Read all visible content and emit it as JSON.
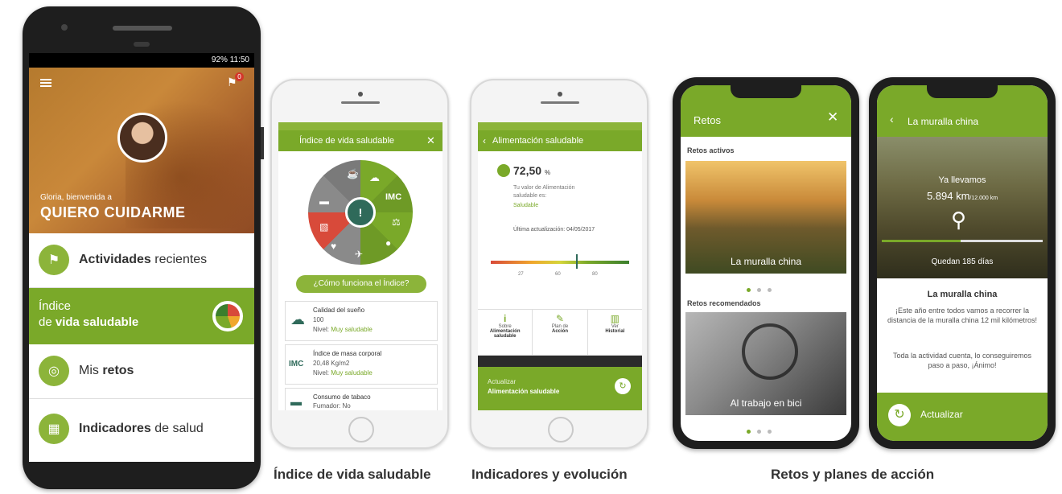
{
  "phone1": {
    "status": "92% 11:50",
    "notif_count": "0",
    "greeting": "Gloria, bienvenida a",
    "brand": "QUIERO CUIDARME",
    "menu": [
      {
        "bold": "Actividades",
        "rest": " recientes"
      },
      {
        "line1": "Índice",
        "line2_pre": "de ",
        "line2_bold": "vida saludable"
      },
      {
        "pre": "Mis ",
        "bold": "retos"
      },
      {
        "bold": "Indicadores",
        "rest": " de salud"
      }
    ]
  },
  "phone2": {
    "title": "Índice de vida saludable",
    "center": "!",
    "imc": "IMC",
    "how_button": "¿Cómo funciona el Índice?",
    "rows": [
      {
        "title": "Calidad del sueño",
        "value": "100",
        "level_label": "Nivel:",
        "level": "Muy saludable"
      },
      {
        "title": "Índice de masa corporal",
        "value": "20,48 Kg/m2",
        "level_label": "Nivel:",
        "level": "Muy saludable",
        "icon": "IMC"
      },
      {
        "title": "Consumo de tabaco",
        "value": "Fumador: No"
      }
    ]
  },
  "phone3": {
    "title": "Alimentación saludable",
    "score": "72,50",
    "score_unit": "%",
    "text1": "Tu valor de Alimentación",
    "text2": "saludable es:",
    "status": "Saludable",
    "updated": "Última actualización: 04/05/2017",
    "scale": [
      "27",
      "60",
      "80"
    ],
    "actions": [
      {
        "icon": "i",
        "l1": "Sobre",
        "l2": "Alimentación",
        "l3": "saludable"
      },
      {
        "icon": "✎",
        "l1": "Plan de",
        "l2": "Acción",
        "l3": ""
      },
      {
        "icon": "▥",
        "l1": "Ver",
        "l2": "Historial",
        "l3": ""
      }
    ],
    "update_label": "Actualizar",
    "update_target": "Alimentación saludable"
  },
  "phone4": {
    "title": "Retos",
    "active_label": "Retos activos",
    "active_card": "La muralla china",
    "recommended_label": "Retos recomendados",
    "recommended_card": "Al trabajo en bici"
  },
  "phone5": {
    "title": "La muralla china",
    "already": "Ya llevamos",
    "km": "5.894 km",
    "km_total": "/12.000 km",
    "remaining": "Quedan 185 días",
    "heading": "La muralla china",
    "body1": "¡Este año entre todos vamos a recorrer la distancia de la muralla china 12 mil kilómetros!",
    "body2": "Toda la actividad cuenta, lo conseguiremos paso a paso, ¡Ánimo!",
    "button": "Actualizar",
    "progress": 0.49
  },
  "captions": {
    "c1": "Índice de vida saludable",
    "c2": "Indicadores y evolución",
    "c3": "Retos y planes de acción"
  },
  "colors": {
    "green": "#7aa929",
    "light_green": "#8cb43a",
    "red": "#d84a3a",
    "gray": "#8a8a8a"
  }
}
